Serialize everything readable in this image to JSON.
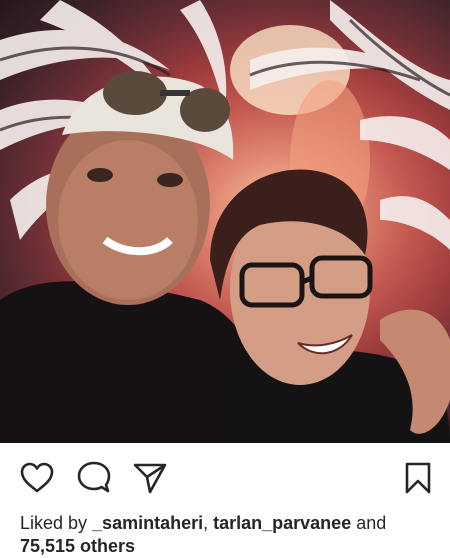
{
  "post": {
    "image_description_icon": "photo",
    "actions": {
      "like_icon": "heart-outline-icon",
      "comment_icon": "comment-bubble-icon",
      "share_icon": "paper-plane-icon",
      "save_icon": "bookmark-icon"
    },
    "likes": {
      "prefix": "Liked by ",
      "user1": "_samintaheri",
      "separator": ", ",
      "user2": "tarlan_parvanee",
      "and": " and",
      "count": "75,515 others"
    }
  },
  "colors": {
    "text": "#262626",
    "icon": "#262626",
    "background": "#ffffff"
  }
}
